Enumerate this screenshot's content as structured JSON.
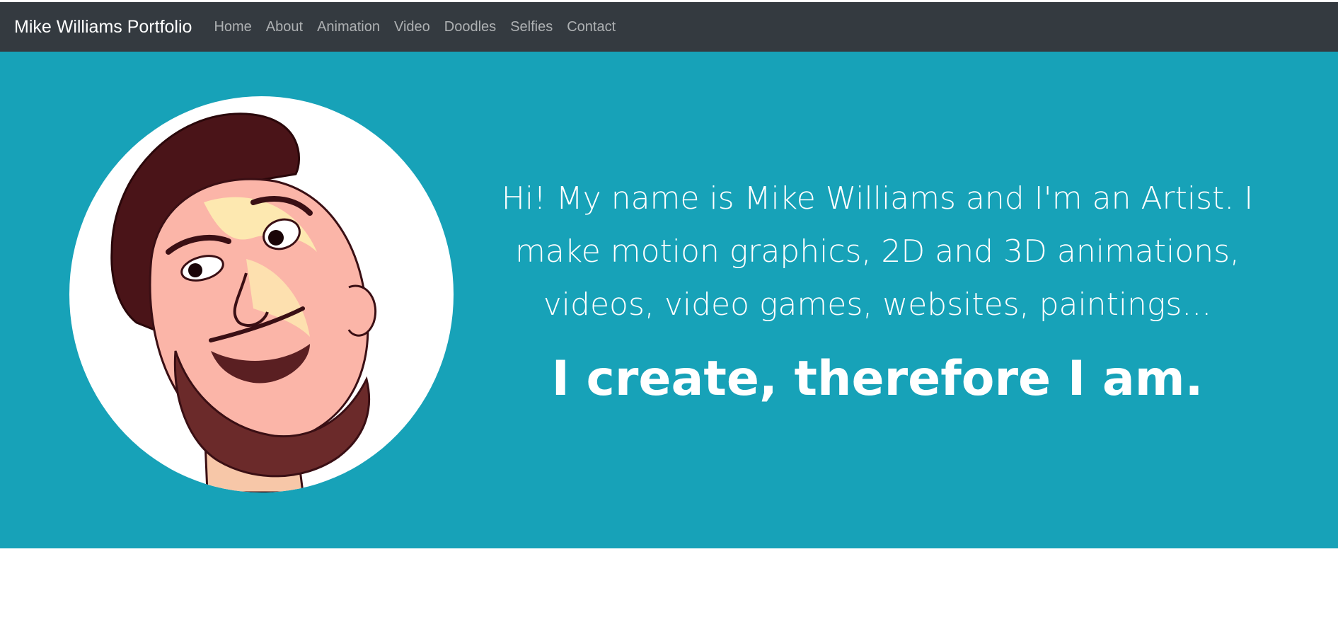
{
  "navbar": {
    "brand": "Mike Williams Portfolio",
    "links": [
      {
        "label": "Home"
      },
      {
        "label": "About"
      },
      {
        "label": "Animation"
      },
      {
        "label": "Video"
      },
      {
        "label": "Doodles"
      },
      {
        "label": "Selfies"
      },
      {
        "label": "Contact"
      }
    ]
  },
  "hero": {
    "intro": "Hi! My name is Mike Williams and I'm an Artist. I make motion graphics, 2D and 3D animations, videos, video games, websites, paintings...",
    "motto": "I create, therefore I am.",
    "avatar_icon": "caricature-self-portrait"
  },
  "colors": {
    "navbar_bg": "#343a40",
    "hero_bg": "#17a2b8",
    "text": "#ffffff"
  }
}
